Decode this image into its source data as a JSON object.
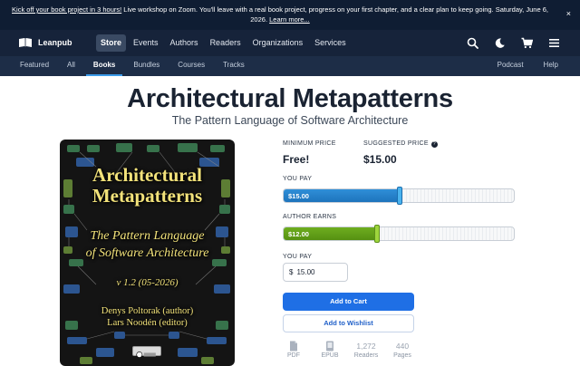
{
  "banner": {
    "link_text": "Kick off your book project in 3 hours!",
    "text": " Live workshop on Zoom. You'll leave with a real book project, progress on your first chapter, and a clear plan to keep going. Saturday, June 6, 2026. ",
    "learn_more": "Learn more...",
    "close": "×"
  },
  "nav": {
    "brand": "Leanpub",
    "links": [
      "Store",
      "Events",
      "Authors",
      "Readers",
      "Organizations",
      "Services"
    ],
    "active": "Store",
    "icons": [
      "search-icon",
      "moon-icon",
      "cart-icon",
      "menu-icon"
    ]
  },
  "subnav": {
    "links": [
      "Featured",
      "All",
      "Books",
      "Bundles",
      "Courses",
      "Tracks"
    ],
    "active": "Books",
    "right": [
      "Podcast",
      "Help"
    ]
  },
  "book": {
    "title": "Architectural Metapatterns",
    "subtitle": "The Pattern Language of Software Architecture",
    "cover": {
      "title_line1": "Architectural",
      "title_line2": "Metapatterns",
      "sub_line1": "The Pattern Language",
      "sub_line2": "of Software Architecture",
      "version": "v 1.2 (05-2026)",
      "author_line": "Denys Poltorak (author)",
      "editor_line": "Lars Noodén (editor)"
    }
  },
  "pricing": {
    "minimum_label": "MINIMUM PRICE",
    "minimum_value": "Free!",
    "suggested_label": "SUGGESTED PRICE",
    "suggested_value": "$15.00",
    "you_pay_label": "YOU PAY",
    "you_pay_value": "$15.00",
    "you_pay_fraction": 0.5,
    "author_earns_label": "AUTHOR EARNS",
    "author_earns_value": "$12.00",
    "author_earns_fraction": 0.4,
    "input_label": "YOU PAY",
    "currency": "$",
    "input_value": "15.00",
    "add_to_cart": "Add to Cart",
    "add_to_wishlist": "Add to Wishlist"
  },
  "stats": [
    {
      "icon": "pdf-icon",
      "value": "",
      "caption": "PDF"
    },
    {
      "icon": "epub-icon",
      "value": "",
      "caption": "EPUB"
    },
    {
      "icon": "",
      "value": "1,272",
      "caption": "Readers"
    },
    {
      "icon": "",
      "value": "440",
      "caption": "Pages"
    }
  ],
  "colors": {
    "nav_bg": "#16233a",
    "banner_bg": "#0f1d33",
    "primary": "#1f6fe5",
    "you_pay_fill": "#1e74bc",
    "author_fill": "#559012"
  }
}
